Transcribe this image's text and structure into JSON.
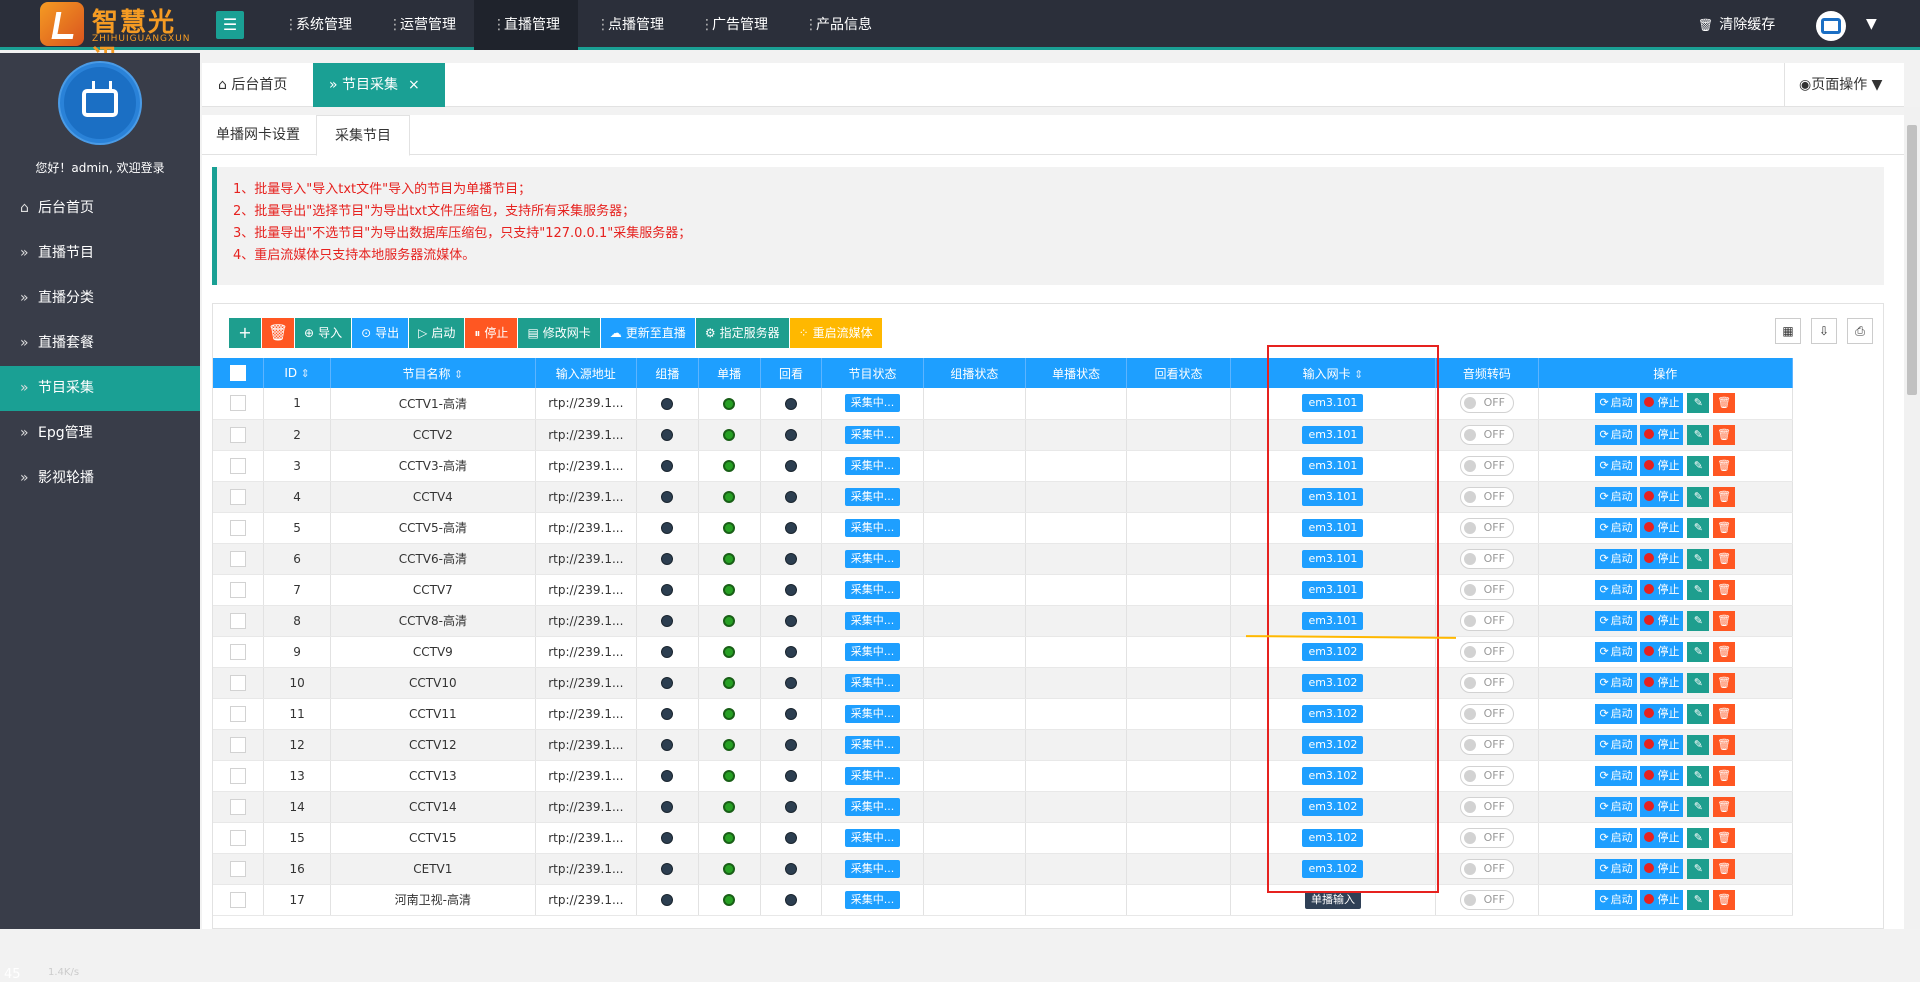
{
  "logo": {
    "text_cn": "智慧光迅",
    "text_en": "ZHIHUIGUANGXUN"
  },
  "top_nav": [
    {
      "label": "系统管理",
      "active": false
    },
    {
      "label": "运营管理",
      "active": false
    },
    {
      "label": "直播管理",
      "active": true
    },
    {
      "label": "点播管理",
      "active": false
    },
    {
      "label": "广告管理",
      "active": false
    },
    {
      "label": "产品信息",
      "active": false
    }
  ],
  "clear_cache": "清除缓存",
  "sidebar": {
    "greeting": "您好！admin, 欢迎登录",
    "items": [
      {
        "label": "后台首页",
        "icon": "home-icon",
        "active": false
      },
      {
        "label": "直播节目",
        "icon": "double-chevron-icon",
        "active": false
      },
      {
        "label": "直播分类",
        "icon": "double-chevron-icon",
        "active": false
      },
      {
        "label": "直播套餐",
        "icon": "double-chevron-icon",
        "active": false
      },
      {
        "label": "节目采集",
        "icon": "double-chevron-icon",
        "active": true
      },
      {
        "label": "Epg管理",
        "icon": "double-chevron-icon",
        "active": false
      },
      {
        "label": "影视轮播",
        "icon": "double-chevron-icon",
        "active": false
      }
    ]
  },
  "speed": {
    "value": "45",
    "rate": "1.4K/s"
  },
  "tabs": {
    "home": "后台首页",
    "active": "节目采集",
    "page_ops": "页面操作"
  },
  "subtabs": [
    "单播网卡设置",
    "采集节目"
  ],
  "notice": [
    "1、批量导入\"导入txt文件\"导入的节目为单播节目；",
    "2、批量导出\"选择节目\"为导出txt文件压缩包，支持所有采集服务器；",
    "3、批量导出\"不选节目\"为导出数据库压缩包，只支持\"127.0.0.1\"采集服务器；",
    "4、重启流媒体只支持本地服务器流媒体。"
  ],
  "toolbar": [
    {
      "label": "",
      "icon": "+",
      "name": "add-button",
      "color": "c-green"
    },
    {
      "label": "",
      "icon": "🗑",
      "name": "delete-button",
      "color": "c-orange"
    },
    {
      "label": "导入",
      "icon": "⊕",
      "name": "import-button",
      "color": "c-green"
    },
    {
      "label": "导出",
      "icon": "⊙",
      "name": "export-button",
      "color": "c-blue"
    },
    {
      "label": "启动",
      "icon": "▷",
      "name": "start-button",
      "color": "c-green"
    },
    {
      "label": "停止",
      "icon": "⏸",
      "name": "stop-button",
      "color": "c-orange"
    },
    {
      "label": "修改网卡",
      "icon": "▤",
      "name": "modify-nic-button",
      "color": "c-green"
    },
    {
      "label": "更新至直播",
      "icon": "☁",
      "name": "update-live-button",
      "color": "c-blue"
    },
    {
      "label": "指定服务器",
      "icon": "⚙",
      "name": "assign-server-button",
      "color": "c-green"
    },
    {
      "label": "重启流媒体",
      "icon": "⁘",
      "name": "restart-media-button",
      "color": "c-yellow"
    }
  ],
  "table": {
    "headers": [
      "",
      "ID",
      "节目名称",
      "输入源地址",
      "组播",
      "单播",
      "回看",
      "节目状态",
      "组播状态",
      "单播状态",
      "回看状态",
      "输入网卡",
      "音频转码",
      "操作"
    ],
    "op_labels": {
      "start": "启动",
      "stop": "停止"
    },
    "rows": [
      {
        "id": "1",
        "name": "CCTV1-高清",
        "src": "rtp://239.1...",
        "status": "采集中...",
        "nic": "em3.101",
        "nic_dark": false,
        "switch": "OFF"
      },
      {
        "id": "2",
        "name": "CCTV2",
        "src": "rtp://239.1...",
        "status": "采集中...",
        "nic": "em3.101",
        "nic_dark": false,
        "switch": "OFF"
      },
      {
        "id": "3",
        "name": "CCTV3-高清",
        "src": "rtp://239.1...",
        "status": "采集中...",
        "nic": "em3.101",
        "nic_dark": false,
        "switch": "OFF"
      },
      {
        "id": "4",
        "name": "CCTV4",
        "src": "rtp://239.1...",
        "status": "采集中...",
        "nic": "em3.101",
        "nic_dark": false,
        "switch": "OFF"
      },
      {
        "id": "5",
        "name": "CCTV5-高清",
        "src": "rtp://239.1...",
        "status": "采集中...",
        "nic": "em3.101",
        "nic_dark": false,
        "switch": "OFF"
      },
      {
        "id": "6",
        "name": "CCTV6-高清",
        "src": "rtp://239.1...",
        "status": "采集中...",
        "nic": "em3.101",
        "nic_dark": false,
        "switch": "OFF"
      },
      {
        "id": "7",
        "name": "CCTV7",
        "src": "rtp://239.1...",
        "status": "采集中...",
        "nic": "em3.101",
        "nic_dark": false,
        "switch": "OFF"
      },
      {
        "id": "8",
        "name": "CCTV8-高清",
        "src": "rtp://239.1...",
        "status": "采集中...",
        "nic": "em3.101",
        "nic_dark": false,
        "switch": "OFF"
      },
      {
        "id": "9",
        "name": "CCTV9",
        "src": "rtp://239.1...",
        "status": "采集中...",
        "nic": "em3.102",
        "nic_dark": false,
        "switch": "OFF"
      },
      {
        "id": "10",
        "name": "CCTV10",
        "src": "rtp://239.1...",
        "status": "采集中...",
        "nic": "em3.102",
        "nic_dark": false,
        "switch": "OFF"
      },
      {
        "id": "11",
        "name": "CCTV11",
        "src": "rtp://239.1...",
        "status": "采集中...",
        "nic": "em3.102",
        "nic_dark": false,
        "switch": "OFF"
      },
      {
        "id": "12",
        "name": "CCTV12",
        "src": "rtp://239.1...",
        "status": "采集中...",
        "nic": "em3.102",
        "nic_dark": false,
        "switch": "OFF"
      },
      {
        "id": "13",
        "name": "CCTV13",
        "src": "rtp://239.1...",
        "status": "采集中...",
        "nic": "em3.102",
        "nic_dark": false,
        "switch": "OFF"
      },
      {
        "id": "14",
        "name": "CCTV14",
        "src": "rtp://239.1...",
        "status": "采集中...",
        "nic": "em3.102",
        "nic_dark": false,
        "switch": "OFF"
      },
      {
        "id": "15",
        "name": "CCTV15",
        "src": "rtp://239.1...",
        "status": "采集中...",
        "nic": "em3.102",
        "nic_dark": false,
        "switch": "OFF"
      },
      {
        "id": "16",
        "name": "CETV1",
        "src": "rtp://239.1...",
        "status": "采集中...",
        "nic": "em3.102",
        "nic_dark": false,
        "switch": "OFF"
      },
      {
        "id": "17",
        "name": "河南卫视-高清",
        "src": "rtp://239.1...",
        "status": "采集中...",
        "nic": "单播输入",
        "nic_dark": true,
        "switch": "OFF"
      }
    ]
  },
  "colors": {
    "accent": "#1aa094",
    "table_header": "#1e9fff",
    "notice_text": "#e6221f",
    "annotation_red": "#e6221f",
    "annotation_yellow": "#ffb800"
  }
}
